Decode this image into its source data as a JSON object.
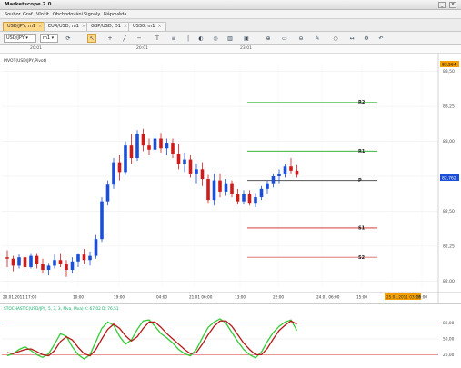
{
  "app_title": "Marketscope 2.0",
  "menu": [
    "Soubor",
    "Graf",
    "Vložit",
    "Obchodování",
    "Signály",
    "Nápověda"
  ],
  "tabs": [
    {
      "label": "USD/JPY, m1",
      "active": true
    },
    {
      "label": "EUR/USD, m1",
      "active": false
    },
    {
      "label": "GBP/USD, D1",
      "active": false
    },
    {
      "label": "US30, m1",
      "active": false
    }
  ],
  "toolbar": {
    "symbol_value": "USD/JPY",
    "timeframe_value": "m1",
    "icons": [
      "cursor-icon",
      "crosshair-icon",
      "trendline-icon",
      "hline-icon",
      "text-icon",
      "fib-icon",
      "zoom-in-icon",
      "zoom-out-icon",
      "indicator-icon",
      "color-icon",
      "shape-icon",
      "settings-icon",
      "arrows-icon"
    ]
  },
  "ruler": {
    "top_labels": [
      "20:01",
      "20:01",
      "23:01"
    ]
  },
  "chart": {
    "indicator_title": "PIVOT(USD/JPY,Pivot)",
    "current_price": "82,762",
    "top_price_tag": "83,564",
    "osc_title": "STOCHASTIC(USD/JPY, 5, 3, 3, Mva, Mva)  K: 67,02  D: 76,51",
    "x_tick_labels": [
      "20.01.2011 17:00",
      "10:00",
      "19:00",
      "04:00",
      "21.01 06:00",
      "13:00",
      "22:00",
      "24.01 06:00",
      "15:00",
      "25.01.2011 03:00",
      "09:00"
    ]
  },
  "chart_data": {
    "type": "candlestick",
    "y_tick_labels": [
      "83,50",
      "83,25",
      "83,00",
      "82,75",
      "82,50",
      "82,25",
      "82,00"
    ],
    "ylim": [
      81.95,
      83.55
    ],
    "pivot_levels": [
      {
        "name": "R2",
        "value": 83.28,
        "color": "#66cc66"
      },
      {
        "name": "R1",
        "value": 82.93,
        "color": "#22aa22"
      },
      {
        "name": "P",
        "value": 82.72,
        "color": "#555555"
      },
      {
        "name": "S1",
        "value": 82.38,
        "color": "#cc2222"
      },
      {
        "name": "S2",
        "value": 82.17,
        "color": "#dd6666"
      }
    ],
    "candles": [
      [
        82.17,
        82.22,
        82.1,
        82.16
      ],
      [
        82.16,
        82.18,
        82.07,
        82.11
      ],
      [
        82.11,
        82.19,
        82.09,
        82.17
      ],
      [
        82.17,
        82.18,
        82.08,
        82.1
      ],
      [
        82.1,
        82.2,
        82.09,
        82.18
      ],
      [
        82.18,
        82.2,
        82.09,
        82.12
      ],
      [
        82.12,
        82.16,
        82.06,
        82.08
      ],
      [
        82.08,
        82.13,
        82.04,
        82.11
      ],
      [
        82.11,
        82.19,
        82.09,
        82.15
      ],
      [
        82.15,
        82.2,
        82.1,
        82.12
      ],
      [
        82.12,
        82.15,
        82.03,
        82.08
      ],
      [
        82.08,
        82.17,
        82.06,
        82.14
      ],
      [
        82.14,
        82.2,
        82.1,
        82.19
      ],
      [
        82.19,
        82.23,
        82.12,
        82.15
      ],
      [
        82.15,
        82.21,
        82.11,
        82.18
      ],
      [
        82.18,
        82.33,
        82.16,
        82.3
      ],
      [
        82.3,
        82.6,
        82.28,
        82.57
      ],
      [
        82.57,
        82.72,
        82.54,
        82.69
      ],
      [
        82.69,
        82.88,
        82.66,
        82.85
      ],
      [
        82.85,
        82.9,
        82.72,
        82.78
      ],
      [
        82.78,
        83.0,
        82.76,
        82.97
      ],
      [
        82.97,
        83.05,
        82.84,
        82.88
      ],
      [
        82.88,
        83.08,
        82.86,
        83.05
      ],
      [
        83.05,
        83.09,
        82.93,
        82.97
      ],
      [
        82.97,
        83.02,
        82.9,
        82.94
      ],
      [
        82.94,
        83.05,
        82.92,
        83.02
      ],
      [
        83.02,
        83.06,
        82.92,
        82.95
      ],
      [
        82.95,
        83.02,
        82.9,
        82.99
      ],
      [
        82.99,
        83.02,
        82.88,
        82.91
      ],
      [
        82.91,
        82.98,
        82.8,
        82.84
      ],
      [
        82.84,
        82.92,
        82.78,
        82.87
      ],
      [
        82.87,
        82.9,
        82.74,
        82.77
      ],
      [
        82.77,
        82.84,
        82.7,
        82.8
      ],
      [
        82.8,
        82.85,
        82.68,
        82.73
      ],
      [
        82.73,
        82.76,
        82.56,
        82.58
      ],
      [
        82.58,
        82.77,
        82.54,
        82.72
      ],
      [
        82.72,
        82.77,
        82.6,
        82.64
      ],
      [
        82.64,
        82.73,
        82.61,
        82.7
      ],
      [
        82.7,
        82.72,
        82.6,
        82.62
      ],
      [
        82.62,
        82.66,
        82.55,
        82.57
      ],
      [
        82.57,
        82.65,
        82.55,
        82.62
      ],
      [
        82.62,
        82.65,
        82.54,
        82.56
      ],
      [
        82.56,
        82.63,
        82.53,
        82.6
      ],
      [
        82.6,
        82.68,
        82.58,
        82.66
      ],
      [
        82.66,
        82.72,
        82.62,
        82.7
      ],
      [
        82.7,
        82.77,
        82.67,
        82.75
      ],
      [
        82.75,
        82.8,
        82.7,
        82.77
      ],
      [
        82.77,
        82.84,
        82.74,
        82.82
      ],
      [
        82.82,
        82.88,
        82.77,
        82.79
      ],
      [
        82.79,
        82.83,
        82.74,
        82.76
      ]
    ],
    "stoch_levels": [
      80,
      20
    ],
    "stoch_y_ticks": [
      "80,00",
      "50,00",
      "20,00"
    ],
    "stoch_k": [
      18,
      22,
      30,
      35,
      28,
      20,
      15,
      22,
      40,
      60,
      55,
      35,
      20,
      12,
      20,
      45,
      70,
      82,
      76,
      55,
      40,
      48,
      68,
      84,
      86,
      74,
      60,
      52,
      42,
      30,
      22,
      18,
      30,
      52,
      72,
      82,
      88,
      80,
      62,
      45,
      30,
      20,
      14,
      25,
      45,
      62,
      74,
      82,
      86,
      66
    ],
    "stoch_d": [
      24,
      22,
      26,
      30,
      31,
      26,
      20,
      18,
      28,
      45,
      54,
      48,
      34,
      22,
      18,
      30,
      50,
      68,
      78,
      70,
      56,
      46,
      54,
      70,
      82,
      82,
      72,
      60,
      50,
      40,
      30,
      22,
      24,
      40,
      58,
      74,
      84,
      84,
      74,
      58,
      42,
      30,
      20,
      20,
      32,
      50,
      66,
      76,
      84,
      78
    ]
  },
  "colors": {
    "bull": "#1c4fd8",
    "bear": "#d11a1a",
    "stoch_k": "#33cc33",
    "stoch_d": "#b31a1a",
    "accent": "#ffd98a"
  }
}
